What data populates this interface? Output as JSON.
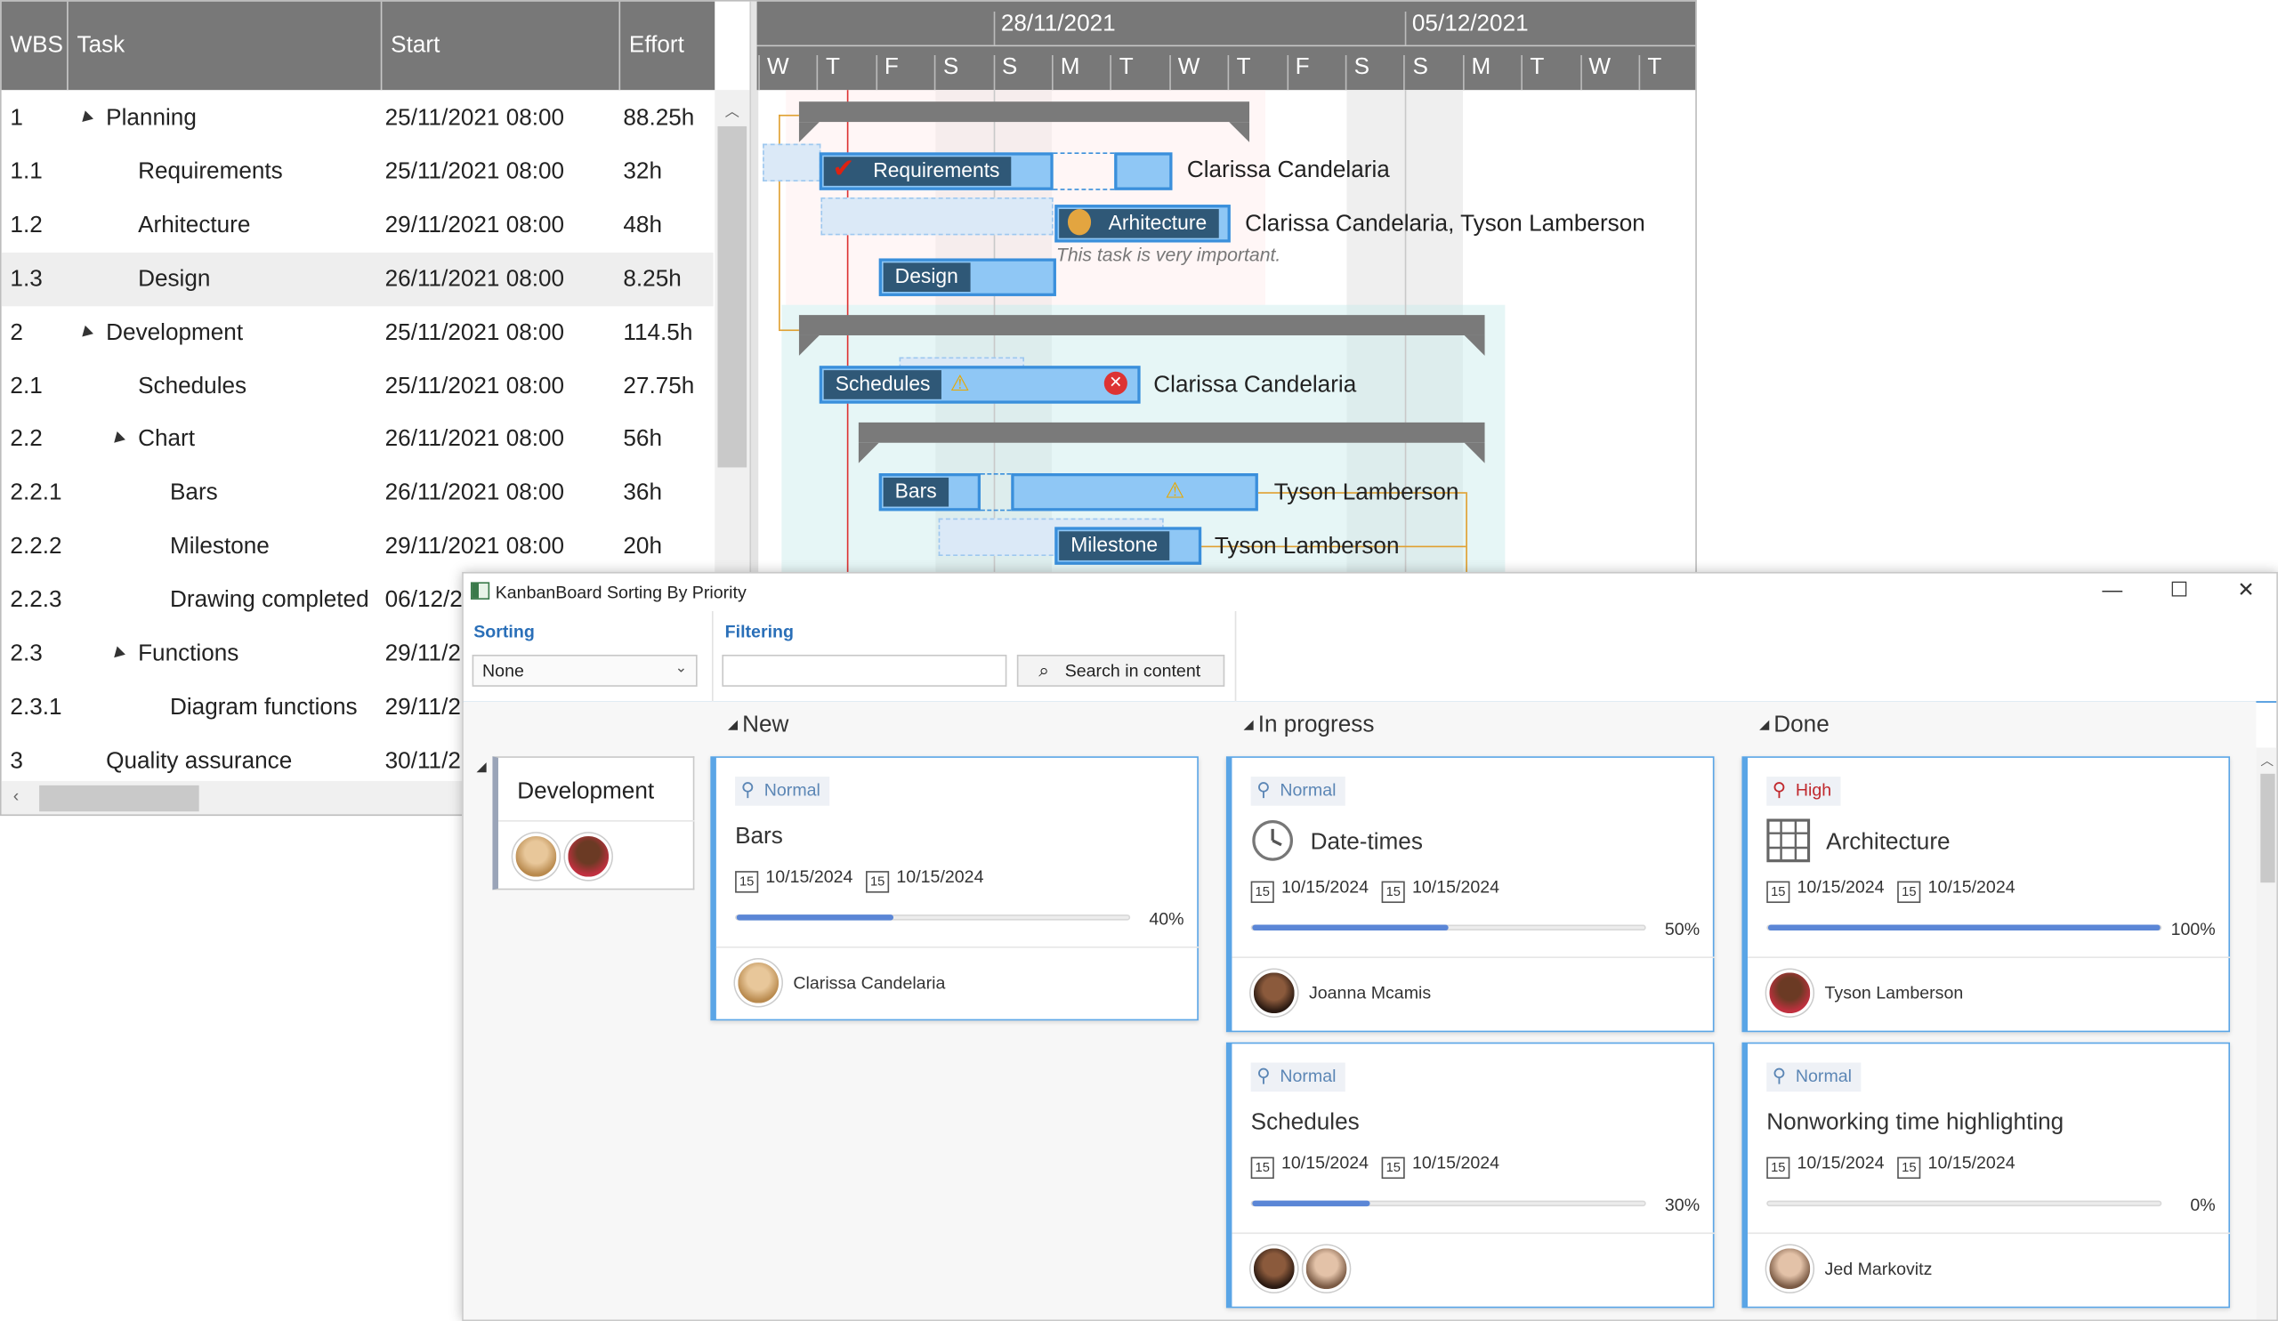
{
  "gantt": {
    "columns": [
      "WBS",
      "Task",
      "Start",
      "Effort"
    ],
    "rows": [
      {
        "wbs": "1",
        "task": "Planning",
        "start": "25/11/2021 08:00",
        "effort": "88.25h"
      },
      {
        "wbs": "1.1",
        "task": "Requirements",
        "start": "25/11/2021 08:00",
        "effort": "32h"
      },
      {
        "wbs": "1.2",
        "task": "Arhitecture",
        "start": "29/11/2021 08:00",
        "effort": "48h"
      },
      {
        "wbs": "1.3",
        "task": "Design",
        "start": "26/11/2021 08:00",
        "effort": "8.25h"
      },
      {
        "wbs": "2",
        "task": "Development",
        "start": "25/11/2021 08:00",
        "effort": "114.5h"
      },
      {
        "wbs": "2.1",
        "task": "Schedules",
        "start": "25/11/2021 08:00",
        "effort": "27.75h"
      },
      {
        "wbs": "2.2",
        "task": "Chart",
        "start": "26/11/2021 08:00",
        "effort": "56h"
      },
      {
        "wbs": "2.2.1",
        "task": "Bars",
        "start": "26/11/2021 08:00",
        "effort": "36h"
      },
      {
        "wbs": "2.2.2",
        "task": "Milestone",
        "start": "29/11/2021 08:00",
        "effort": "20h"
      },
      {
        "wbs": "2.2.3",
        "task": "Drawing completed",
        "start": "06/12/2",
        "effort": ""
      },
      {
        "wbs": "2.3",
        "task": "Functions",
        "start": "29/11/2",
        "effort": ""
      },
      {
        "wbs": "2.3.1",
        "task": "Diagram functions",
        "start": "29/11/2",
        "effort": ""
      },
      {
        "wbs": "3",
        "task": "Quality assurance",
        "start": "30/11/2",
        "effort": ""
      }
    ],
    "timeline": {
      "weeks": [
        "28/11/2021",
        "05/12/2021"
      ],
      "days": [
        "W",
        "T",
        "F",
        "S",
        "S",
        "M",
        "T",
        "W",
        "T",
        "F",
        "S",
        "S",
        "M",
        "T",
        "W",
        "T"
      ]
    },
    "bars": {
      "requirements": "Requirements",
      "arhitecture": "Arhitecture",
      "design": "Design",
      "schedules": "Schedules",
      "bars": "Bars",
      "milestone": "Milestone"
    },
    "assignments": {
      "requirements": "Clarissa Candelaria",
      "arhitecture": "Clarissa Candelaria, Tyson Lamberson",
      "schedules": "Clarissa Candelaria",
      "bars": "Tyson Lamberson",
      "milestone": "Tyson Lamberson"
    },
    "note": "This task is very important."
  },
  "kanban": {
    "window_title": "KanbanBoard Sorting By Priority",
    "window_buttons": {
      "minimize": "—",
      "maximize": "☐",
      "close": "✕"
    },
    "toolbar": {
      "sorting_label": "Sorting",
      "sorting_value": "None",
      "filtering_label": "Filtering",
      "filter_placeholder": "",
      "search_button": "Search in content"
    },
    "columns": [
      "New",
      "In progress",
      "Done"
    ],
    "swimlane": "Development",
    "cards": [
      {
        "priority": "Normal",
        "title": "Bars",
        "start": "10/15/2024",
        "end": "10/15/2024",
        "progress": 40,
        "progress_label": "40%",
        "assignee": "Clarissa Candelaria"
      },
      {
        "priority": "Normal",
        "title": "Date-times",
        "start": "10/15/2024",
        "end": "10/15/2024",
        "progress": 50,
        "progress_label": "50%",
        "assignee": "Joanna Mcamis"
      },
      {
        "priority": "High",
        "title": "Architecture",
        "start": "10/15/2024",
        "end": "10/15/2024",
        "progress": 100,
        "progress_label": "100%",
        "assignee": "Tyson Lamberson"
      },
      {
        "priority": "Normal",
        "title": "Schedules",
        "start": "10/15/2024",
        "end": "10/15/2024",
        "progress": 30,
        "progress_label": "30%",
        "assignee": ""
      },
      {
        "priority": "Normal",
        "title": "Nonworking time highlighting",
        "start": "10/15/2024",
        "end": "10/15/2024",
        "progress": 0,
        "progress_label": "0%",
        "assignee": "Jed Markovitz"
      }
    ],
    "colors": {
      "accent": "#3a8fdb",
      "card_border": "#5aa5e6",
      "progress": "#5b86d6",
      "high": "#c0282d"
    }
  }
}
